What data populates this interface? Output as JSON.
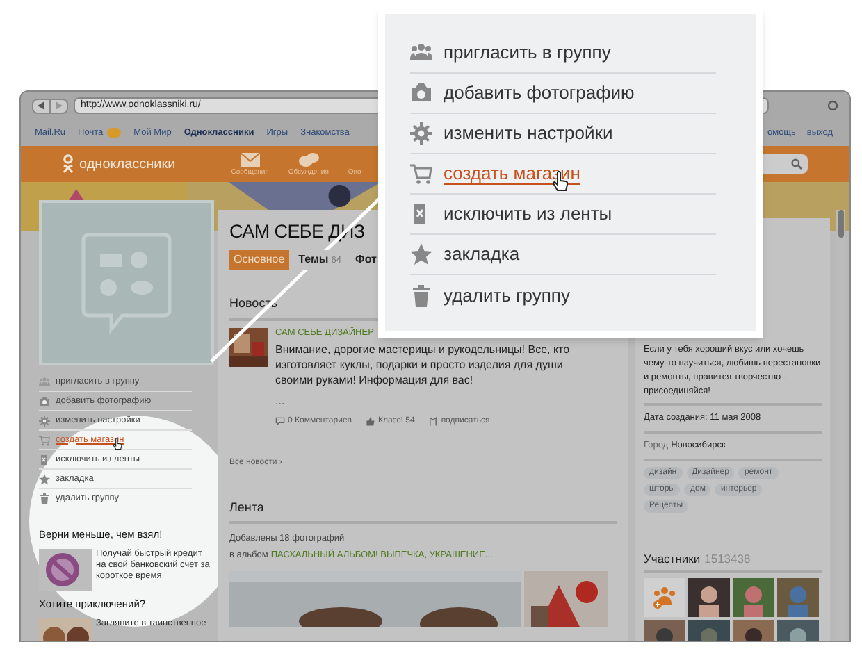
{
  "browser": {
    "url": "http://www.odnoklassniki.ru/"
  },
  "top_links": [
    {
      "label": "Mail.Ru",
      "bold": false,
      "badge": false
    },
    {
      "label": "Почта",
      "bold": false,
      "badge": true
    },
    {
      "label": "Мой Мир",
      "bold": false,
      "badge": false
    },
    {
      "label": "Одноклассники",
      "bold": true,
      "badge": false
    },
    {
      "label": "Игры",
      "bold": false,
      "badge": false
    },
    {
      "label": "Знакомства",
      "bold": false,
      "badge": false
    }
  ],
  "right_links": [
    "омощь",
    "выход"
  ],
  "header": {
    "logo": "одноклассники",
    "nav": [
      {
        "label": "Сообщения",
        "kind": "mail"
      },
      {
        "label": "Обсуждения",
        "kind": "chat"
      },
      {
        "label": "Опо",
        "kind": "none"
      }
    ]
  },
  "popup_menu": [
    {
      "label": "пригласить в группу",
      "kind": "invite",
      "selected": false
    },
    {
      "label": "добавить фотографию",
      "selected": false
    },
    {
      "label": "изменить настройки",
      "kind": "settings",
      "selected": false
    },
    {
      "label": "создать магазин",
      "kind": "shop",
      "selected": true
    },
    {
      "label": "исключить из ленты",
      "kind": "exclude",
      "selected": false
    },
    {
      "label": "закладка",
      "kind": "bookmark",
      "selected": false
    },
    {
      "label": "удалить группу",
      "kind": "delete",
      "selected": false
    }
  ],
  "sidebar_menu": [
    {
      "label": "пригласить в группу",
      "kind": "invite",
      "selected": false
    },
    {
      "label": "добавить фотографию",
      "selected": false
    },
    {
      "label": "изменить настройки",
      "kind": "settings",
      "selected": false
    },
    {
      "label": "создать магазин",
      "kind": "shop",
      "selected": true
    },
    {
      "label": "исключить из ленты",
      "kind": "exclude",
      "selected": false
    },
    {
      "label": "закладка",
      "kind": "bookmark",
      "selected": false
    },
    {
      "label": "удалить группу",
      "kind": "delete",
      "selected": false
    }
  ],
  "ads": [
    {
      "title": "Верни меньше, чем взял!",
      "text": "Получай быстрый кредит на свой банковский счет за короткое время"
    },
    {
      "title": "Хотите приключений?",
      "text": "Загляните в таинственное"
    }
  ],
  "group": {
    "title": "САМ СЕБЕ ДИЗ",
    "tabs": [
      {
        "label": "Основное",
        "selected": true
      },
      {
        "label": "Темы",
        "count": "64",
        "selected": false
      },
      {
        "label": "Фот",
        "selected": false
      }
    ]
  },
  "news": {
    "heading": "Новость",
    "author": "САМ СЕБЕ ДИЗАЙНЕР",
    "text": "Внимание, дорогие мастерицы и рукодельницы! Все, кто изготовляет куклы, подарки и просто изделия для души своими руками! Информация для вас!",
    "ellipsis": "...",
    "actions": [
      {
        "kind": "comment",
        "label": "0 Комментариев"
      },
      {
        "kind": "like",
        "label": "Класс! 54"
      },
      {
        "kind": "subscribe",
        "label": "подписаться"
      }
    ],
    "more": "Все новости ›"
  },
  "feed": {
    "heading": "Лента",
    "line1": "Добавлены 18 фотографий",
    "line2_prefix": "в альбом",
    "album": "ПАСХАЛЬНЫЙ АЛЬБОМ! ВЫПЕЧКА, УКРАШЕНИЕ..."
  },
  "about": {
    "description": "Если у тебя хороший вкус или хочешь чему-то научиться, любишь перестановки и ремонты, нравится творчество - присоединяйся!",
    "created": "Дата создания: 11 мая 2008",
    "city_label": "Город",
    "city": "Новосибирск",
    "tags": [
      "дизайн",
      "Дизайнер",
      "ремонт",
      "шторы",
      "дом",
      "интерьер",
      "Рецепты"
    ]
  },
  "members": {
    "label": "Участники",
    "count": "1513438"
  }
}
